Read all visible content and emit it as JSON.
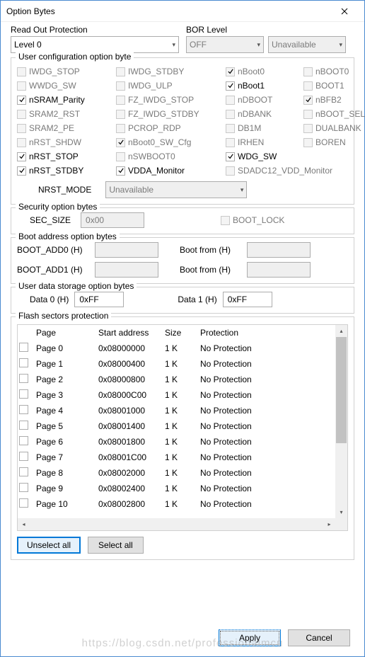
{
  "window": {
    "title": "Option Bytes"
  },
  "readOut": {
    "label": "Read Out Protection",
    "value": "Level 0"
  },
  "bor": {
    "label": "BOR Level",
    "value": "OFF",
    "extra": "Unavailable"
  },
  "userConfig": {
    "legend": "User configuration option byte",
    "items": [
      [
        {
          "l": "IWDG_STOP",
          "c": false,
          "d": true
        },
        {
          "l": "IWDG_STDBY",
          "c": false,
          "d": true
        },
        {
          "l": "nBoot0",
          "c": true,
          "d": true
        },
        {
          "l": "nBOOT0",
          "c": false,
          "d": true
        }
      ],
      [
        {
          "l": "WWDG_SW",
          "c": false,
          "d": true
        },
        {
          "l": "IWDG_ULP",
          "c": false,
          "d": true
        },
        {
          "l": "nBoot1",
          "c": true,
          "d": false
        },
        {
          "l": "BOOT1",
          "c": false,
          "d": true
        }
      ],
      [
        {
          "l": "nSRAM_Parity",
          "c": true,
          "d": false
        },
        {
          "l": "FZ_IWDG_STOP",
          "c": false,
          "d": true
        },
        {
          "l": "nDBOOT",
          "c": false,
          "d": true
        },
        {
          "l": "nBFB2",
          "c": true,
          "d": true
        }
      ],
      [
        {
          "l": "SRAM2_RST",
          "c": false,
          "d": true
        },
        {
          "l": "FZ_IWDG_STDBY",
          "c": false,
          "d": true
        },
        {
          "l": "nDBANK",
          "c": false,
          "d": true
        },
        {
          "l": "nBOOT_SEL",
          "c": false,
          "d": true
        }
      ],
      [
        {
          "l": "SRAM2_PE",
          "c": false,
          "d": true
        },
        {
          "l": "PCROP_RDP",
          "c": false,
          "d": true
        },
        {
          "l": "DB1M",
          "c": false,
          "d": true
        },
        {
          "l": "DUALBANK",
          "c": false,
          "d": true
        }
      ],
      [
        {
          "l": "nRST_SHDW",
          "c": false,
          "d": true
        },
        {
          "l": "nBoot0_SW_Cfg",
          "c": true,
          "d": true
        },
        {
          "l": "IRHEN",
          "c": false,
          "d": true
        },
        {
          "l": "BOREN",
          "c": false,
          "d": true
        }
      ],
      [
        {
          "l": "nRST_STOP",
          "c": true,
          "d": false
        },
        {
          "l": "nSWBOOT0",
          "c": false,
          "d": true
        },
        {
          "l": "WDG_SW",
          "c": true,
          "d": false
        },
        {
          "l": "",
          "c": false,
          "d": true,
          "empty": true
        }
      ],
      [
        {
          "l": "nRST_STDBY",
          "c": true,
          "d": false
        },
        {
          "l": "VDDA_Monitor",
          "c": true,
          "d": false
        },
        {
          "l": "SDADC12_VDD_Monitor",
          "c": false,
          "d": true,
          "span": 2
        }
      ]
    ],
    "nrst_label": "NRST_MODE",
    "nrst_value": "Unavailable"
  },
  "security": {
    "legend": "Security option bytes",
    "sec_size_label": "SEC_SIZE",
    "sec_size_value": "0x00",
    "boot_lock_label": "BOOT_LOCK"
  },
  "bootAddr": {
    "legend": "Boot address option bytes",
    "add0": "BOOT_ADD0 (H)",
    "add1": "BOOT_ADD1 (H)",
    "bootfrom": "Boot from (H)"
  },
  "userData": {
    "legend": "User data storage option bytes",
    "d0_label": "Data 0 (H)",
    "d0_value": "0xFF",
    "d1_label": "Data 1 (H)",
    "d1_value": "0xFF"
  },
  "flash": {
    "legend": "Flash sectors protection",
    "cols": {
      "page": "Page",
      "addr": "Start address",
      "size": "Size",
      "prot": "Protection"
    },
    "rows": [
      {
        "p": "Page 0",
        "a": "0x08000000",
        "s": "1 K",
        "pr": "No Protection"
      },
      {
        "p": "Page 1",
        "a": "0x08000400",
        "s": "1 K",
        "pr": "No Protection"
      },
      {
        "p": "Page 2",
        "a": "0x08000800",
        "s": "1 K",
        "pr": "No Protection"
      },
      {
        "p": "Page 3",
        "a": "0x08000C00",
        "s": "1 K",
        "pr": "No Protection"
      },
      {
        "p": "Page 4",
        "a": "0x08001000",
        "s": "1 K",
        "pr": "No Protection"
      },
      {
        "p": "Page 5",
        "a": "0x08001400",
        "s": "1 K",
        "pr": "No Protection"
      },
      {
        "p": "Page 6",
        "a": "0x08001800",
        "s": "1 K",
        "pr": "No Protection"
      },
      {
        "p": "Page 7",
        "a": "0x08001C00",
        "s": "1 K",
        "pr": "No Protection"
      },
      {
        "p": "Page 8",
        "a": "0x08002000",
        "s": "1 K",
        "pr": "No Protection"
      },
      {
        "p": "Page 9",
        "a": "0x08002400",
        "s": "1 K",
        "pr": "No Protection"
      },
      {
        "p": "Page 10",
        "a": "0x08002800",
        "s": "1 K",
        "pr": "No Protection"
      }
    ],
    "unselect": "Unselect all",
    "select": "Select all"
  },
  "buttons": {
    "apply": "Apply",
    "cancel": "Cancel"
  },
  "watermark": "https://blog.csdn.net/professionalmcu"
}
